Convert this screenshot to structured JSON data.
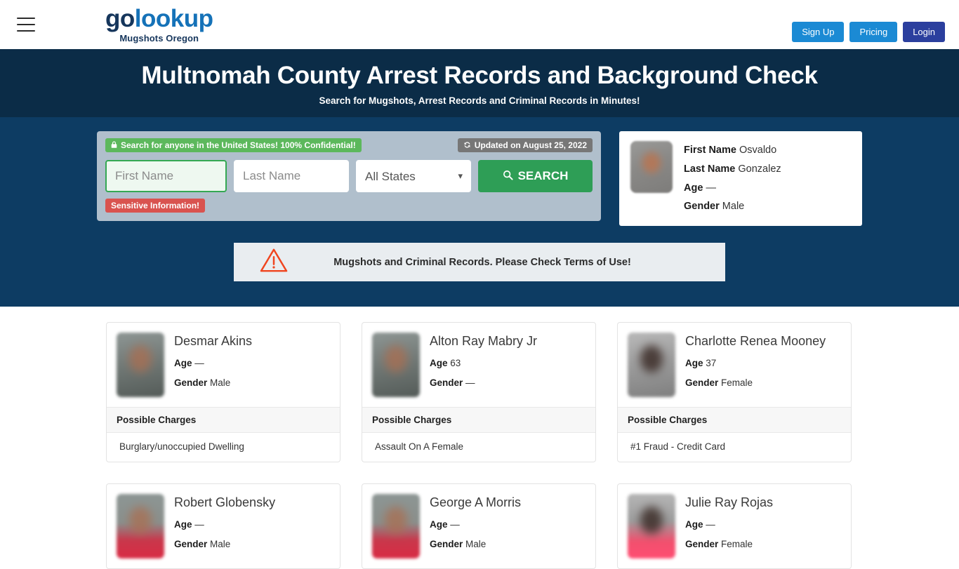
{
  "header": {
    "menu_icon": "hamburger-menu-icon",
    "logo_go": "go",
    "logo_lookup": "lookup",
    "logo_subtitle": "Mugshots Oregon",
    "buttons": {
      "sign_up": "Sign Up",
      "pricing": "Pricing",
      "login": "Login"
    },
    "colors": {
      "signup_bg": "#1b8ad4",
      "pricing_bg": "#1b8ad4",
      "login_bg": "#2b3f9e",
      "logo_blue": "#1572b8",
      "logo_dark": "#16365c"
    }
  },
  "title_band": {
    "heading": "Multnomah County Arrest Records and Background Check",
    "subheading": "Search for Mugshots, Arrest Records and Criminal Records in Minutes!",
    "bg": "#0b2c47"
  },
  "hero": {
    "bg": "#0d3c63",
    "panel_bg": "#b0bfcc",
    "confidential_badge": {
      "icon": "lock-icon",
      "text": "Search for anyone in the United States! 100% Confidential!",
      "bg": "#5cb85c"
    },
    "updated_badge": {
      "icon": "refresh-icon",
      "text": "Updated on August 25, 2022",
      "bg": "#777777"
    },
    "sensitive_badge": {
      "text": "Sensitive Information!",
      "bg": "#d9534f"
    },
    "search": {
      "first_name_placeholder": "First Name",
      "first_name_value": "",
      "last_name_placeholder": "Last Name",
      "last_name_value": "",
      "state_selected": "All States",
      "state_chevron": "chevron-down-icon",
      "search_icon": "search-icon",
      "search_label": "SEARCH",
      "search_bg": "#2e9e56",
      "focus_border": "#34a853"
    }
  },
  "person_card": {
    "avatar": "mugshot-thumbnail",
    "rows": [
      {
        "label": "First Name",
        "value": "Osvaldo"
      },
      {
        "label": "Last Name",
        "value": "Gonzalez"
      },
      {
        "label": "Age",
        "value": "—"
      },
      {
        "label": "Gender",
        "value": "Male"
      }
    ]
  },
  "warning": {
    "icon": "warning-triangle-icon",
    "icon_color": "#f0451f",
    "text": "Mugshots and Criminal Records. Please Check Terms of Use!",
    "bg": "#e9edf0"
  },
  "results": {
    "charges_header": "Possible Charges",
    "age_label": "Age",
    "gender_label": "Gender",
    "cards": [
      {
        "name": "Desmar Akins",
        "age": "—",
        "gender": "Male",
        "charge": "Burglary/unoccupied Dwelling",
        "photo_style": "gray",
        "has_charges": true
      },
      {
        "name": "Alton Ray Mabry Jr",
        "age": "63",
        "gender": "—",
        "charge": "Assault On A Female",
        "photo_style": "gray",
        "has_charges": true
      },
      {
        "name": "Charlotte Renea Mooney",
        "age": "37",
        "gender": "Female",
        "charge": "#1 Fraud - Credit Card",
        "photo_style": "lightgray dark",
        "has_charges": true
      },
      {
        "name": "Robert Globensky",
        "age": "—",
        "gender": "Male",
        "charge": "",
        "photo_style": "red",
        "has_charges": false
      },
      {
        "name": "George A Morris",
        "age": "—",
        "gender": "Male",
        "charge": "",
        "photo_style": "red",
        "has_charges": false
      },
      {
        "name": "Julie Ray Rojas",
        "age": "—",
        "gender": "Female",
        "charge": "",
        "photo_style": "pink dark",
        "has_charges": false
      }
    ]
  }
}
